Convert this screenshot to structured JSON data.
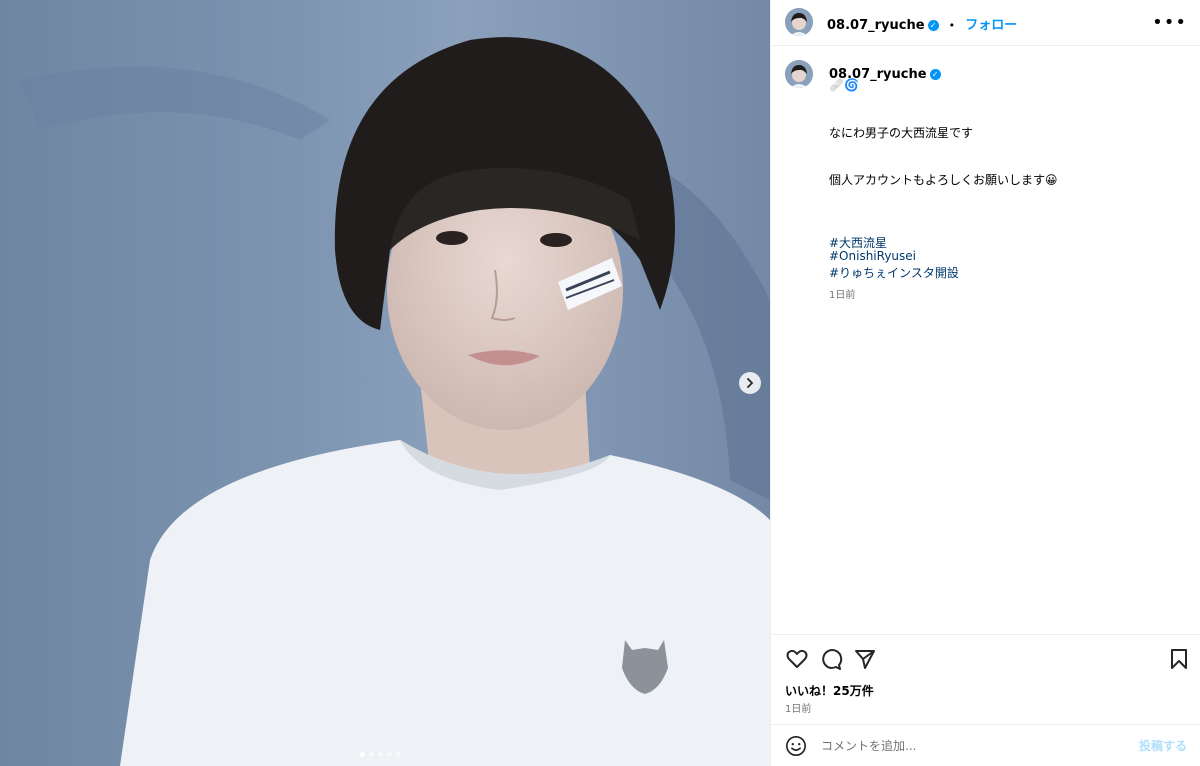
{
  "header": {
    "username": "08.07_ryuche",
    "separator": "•",
    "follow_label": "フォロー",
    "more_icon": "more-horizontal-icon"
  },
  "caption": {
    "username": "08.07_ryuche",
    "emoji_line": "🩹🌀",
    "line1": "なにわ男子の大西流星です",
    "line2": "個人アカウントもよろしくお願いします😀",
    "hashtags": [
      "#大西流星",
      "#OnishiRyusei",
      "#りゅちぇインスタ開設"
    ],
    "time": "1日前"
  },
  "actions": {
    "like_icon": "heart-icon",
    "comment_icon": "comment-icon",
    "share_icon": "share-icon",
    "save_icon": "bookmark-icon"
  },
  "likes_text": "いいね！25万件",
  "date_text": "1日前",
  "comment": {
    "placeholder": "コメントを追加...",
    "post_label": "投稿する"
  },
  "carousel": {
    "slide_count": 5,
    "current_slide": 1
  },
  "colors": {
    "accent": "#0095f6",
    "hashtag": "#00376b",
    "muted": "#737373"
  }
}
